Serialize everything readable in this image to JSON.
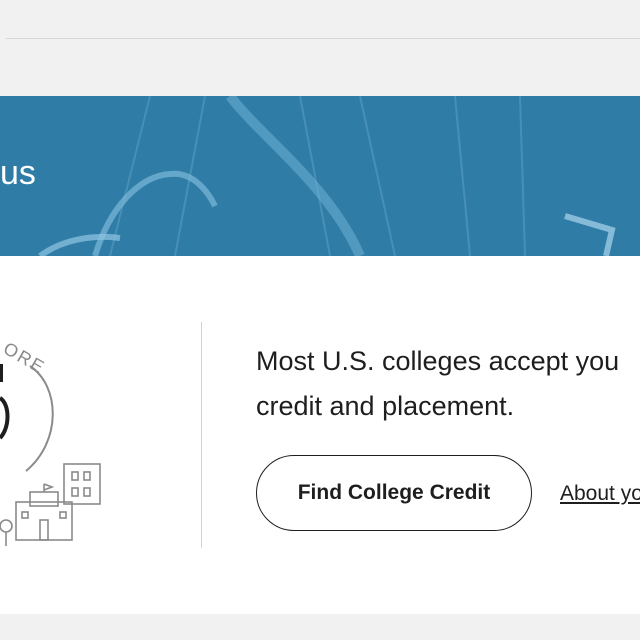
{
  "hero": {
    "title": "us"
  },
  "card": {
    "badge_text": "ORE",
    "body_line1": "Most U.S. colleges accept you",
    "body_line2": "credit and placement.",
    "primary_button": "Find College Credit",
    "secondary_link": "About yo"
  }
}
